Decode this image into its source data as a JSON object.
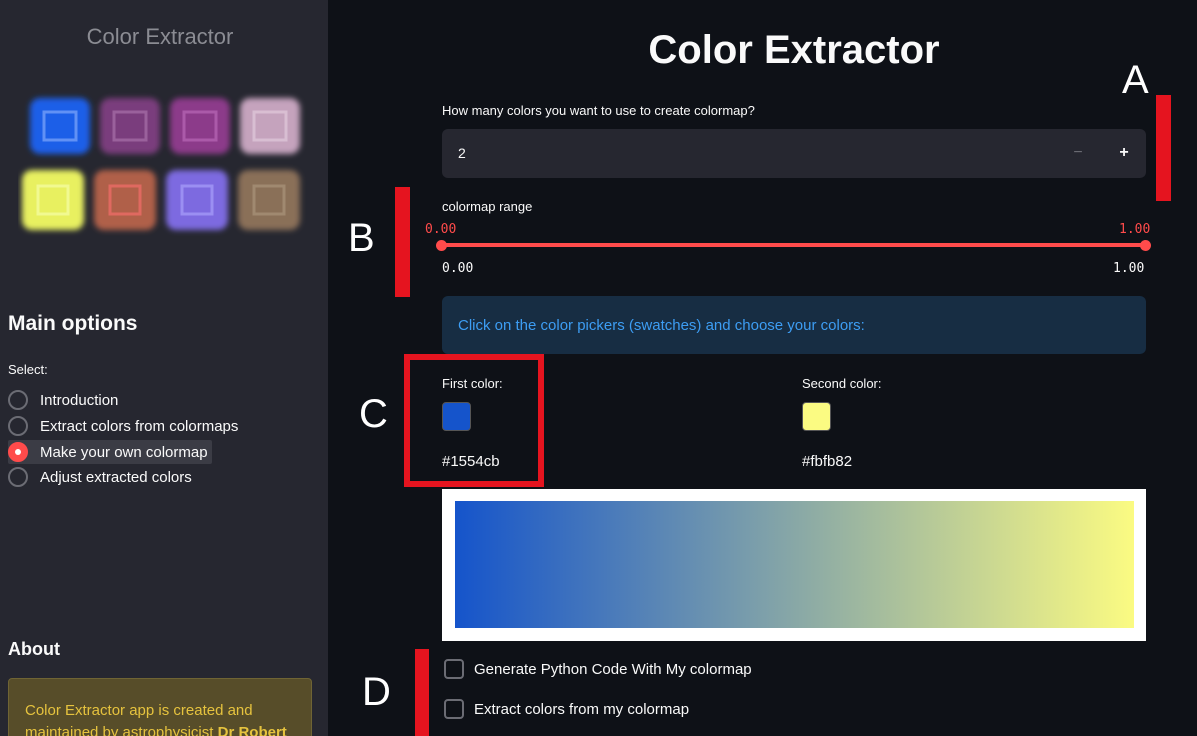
{
  "sidebar": {
    "app_title": "Color Extractor",
    "logo_colors": [
      "#1f5ee8",
      "#7a3d7d",
      "#8c3a8a",
      "#c5a3bd",
      "#e8f060",
      "#b06048",
      "#7d6ae0",
      "#8a7058"
    ],
    "main_options_heading": "Main options",
    "select_label": "Select:",
    "radio_items": [
      {
        "label": "Introduction",
        "selected": false
      },
      {
        "label": "Extract colors from colormaps",
        "selected": false
      },
      {
        "label": "Make your own colormap",
        "selected": true
      },
      {
        "label": "Adjust extracted colors",
        "selected": false
      }
    ],
    "about_heading": "About",
    "about_text": "Color Extractor app is created and maintained by astrophysicist",
    "about_name": "Dr Robert"
  },
  "main": {
    "title": "Color Extractor",
    "num_colors_label": "How many colors you want to use to create colormap?",
    "num_colors_value": "2",
    "minus_symbol": "−",
    "plus_symbol": "+",
    "range_label": "colormap range",
    "range_low": "0.00",
    "range_high": "1.00",
    "range_min": "0.00",
    "range_max": "1.00",
    "info_text": "Click on the color pickers (swatches) and choose your colors:",
    "first_color_label": "First color:",
    "first_color_hex": "#1554cb",
    "second_color_label": "Second color:",
    "second_color_hex": "#fbfb82",
    "checkbox_python": "Generate Python Code With My colormap",
    "checkbox_extract": "Extract colors from my colormap"
  },
  "annotations": {
    "a": "A",
    "b": "B",
    "c": "C",
    "d": "D"
  },
  "colors": {
    "accent": "#ff4b4b",
    "annotation_red": "#e5141f",
    "info_bg": "#172d43",
    "info_text": "#3d9df3"
  }
}
